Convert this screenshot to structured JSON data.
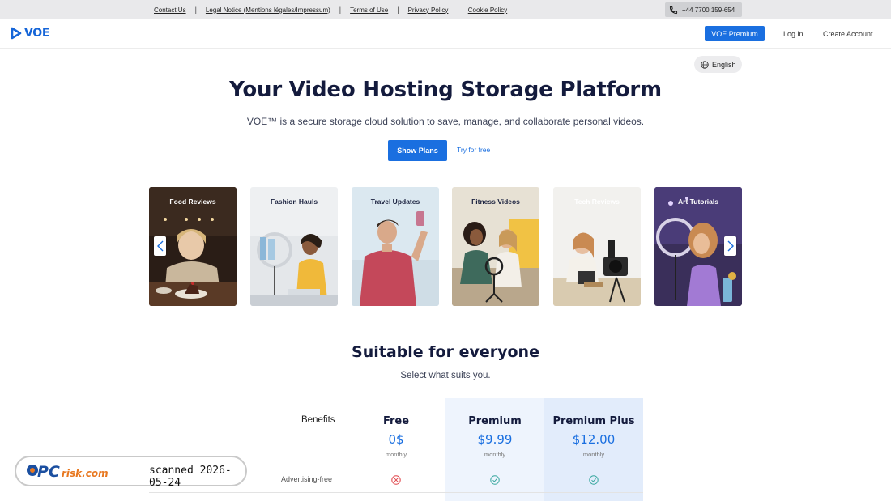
{
  "topbar": {
    "links": [
      "Contact Us",
      "Legal Notice (Mentions légales/Impressum)",
      "Terms of Use",
      "Privacy Policy",
      "Cookie Policy"
    ],
    "phone": "+44 7700 159-654"
  },
  "header": {
    "logo_text": "VOE",
    "premium_label": "VOE Premium",
    "login_label": "Log in",
    "create_label": "Create Account"
  },
  "language": "English",
  "hero": {
    "title": "Your Video Hosting Storage Platform",
    "subtitle": "VOE™ is a secure storage cloud solution to save, manage, and collaborate personal videos.",
    "show_plans": "Show Plans",
    "try_free": "Try for free"
  },
  "carousel": {
    "cards": [
      {
        "label": "Food Reviews"
      },
      {
        "label": "Fashion Hauls"
      },
      {
        "label": "Travel Updates"
      },
      {
        "label": "Fitness Videos"
      },
      {
        "label": "Tech Reviews"
      },
      {
        "label": "Art Tutorials"
      }
    ]
  },
  "pricing": {
    "title": "Suitable for everyone",
    "subtitle": "Select what suits you.",
    "benefits_label": "Benefits",
    "plans": [
      {
        "name": "Free",
        "price": "0$",
        "period": "monthly"
      },
      {
        "name": "Premium",
        "price": "$9.99",
        "period": "monthly"
      },
      {
        "name": "Premium Plus",
        "price": "$12.00",
        "period": "monthly"
      }
    ],
    "rows": [
      {
        "label": "Advertising-free",
        "values": [
          "no",
          "yes",
          "yes"
        ]
      }
    ]
  },
  "watermark": {
    "brand": "PCrisk.com",
    "text": "scanned 2026-05-24"
  },
  "colors": {
    "accent": "#1a6fe0",
    "heading": "#141b3d",
    "no_icon": "#e0464b",
    "yes_icon": "#3aa8a0"
  }
}
